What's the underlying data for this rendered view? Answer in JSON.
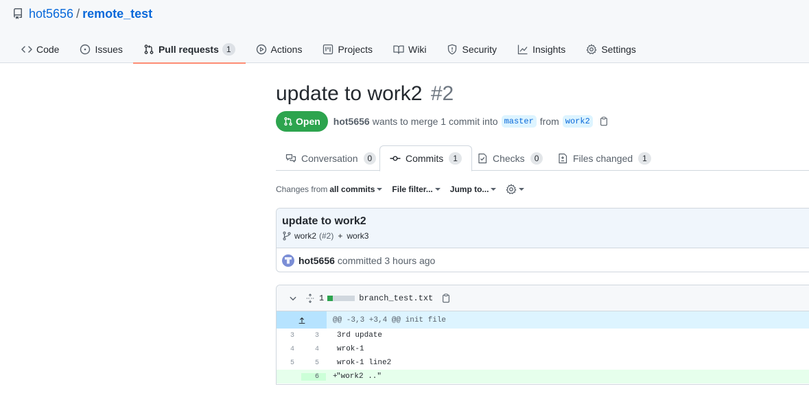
{
  "repo": {
    "owner": "hot5656",
    "separator": "/",
    "name": "remote_test",
    "icon": "repo-icon"
  },
  "nav": [
    {
      "label": "Code",
      "icon": "code-icon"
    },
    {
      "label": "Issues",
      "icon": "issue-icon"
    },
    {
      "label": "Pull requests",
      "icon": "pull-request-icon",
      "count": "1",
      "selected": true
    },
    {
      "label": "Actions",
      "icon": "play-icon"
    },
    {
      "label": "Projects",
      "icon": "project-icon"
    },
    {
      "label": "Wiki",
      "icon": "book-icon"
    },
    {
      "label": "Security",
      "icon": "shield-icon"
    },
    {
      "label": "Insights",
      "icon": "graph-icon"
    },
    {
      "label": "Settings",
      "icon": "gear-icon"
    }
  ],
  "pr": {
    "title": "update to work2",
    "number": "#2",
    "state": "Open",
    "author": "hot5656",
    "action_text": "wants to merge 1 commit into",
    "base_branch": "master",
    "from_text": "from",
    "head_branch": "work2"
  },
  "tabs": [
    {
      "label": "Conversation",
      "count": "0",
      "icon": "comment-discussion-icon"
    },
    {
      "label": "Commits",
      "count": "1",
      "icon": "git-commit-icon",
      "selected": true
    },
    {
      "label": "Checks",
      "count": "0",
      "icon": "checklist-icon"
    },
    {
      "label": "Files changed",
      "count": "1",
      "icon": "file-diff-icon"
    }
  ],
  "toolbar": {
    "changes_from_prefix": "Changes from",
    "changes_from_value": "all commits",
    "file_filter": "File filter...",
    "jump_to": "Jump to...",
    "settings_icon": "gear-icon"
  },
  "commit": {
    "title": "update to work2",
    "branch": "work2",
    "branch_pr": "(#2)",
    "plus": "+",
    "other_branch": "work3",
    "author": "hot5656",
    "committed_text": "committed 3 hours ago"
  },
  "file": {
    "change_count": "1",
    "name": "branch_test.txt",
    "hunk": "@@ -3,3 +3,4 @@ init file",
    "colors": {
      "added": "#2da44e",
      "neutral": "#d0d7de"
    },
    "lines": [
      {
        "old": "3",
        "new": "3",
        "marker": "",
        "text": "3rd update",
        "type": "context"
      },
      {
        "old": "4",
        "new": "4",
        "marker": "",
        "text": "wrok-1",
        "type": "context"
      },
      {
        "old": "5",
        "new": "5",
        "marker": "",
        "text": "wrok-1 line2",
        "type": "context"
      },
      {
        "old": "",
        "new": "6",
        "marker": "+",
        "text": "\"work2 ..\"",
        "type": "added"
      }
    ]
  }
}
